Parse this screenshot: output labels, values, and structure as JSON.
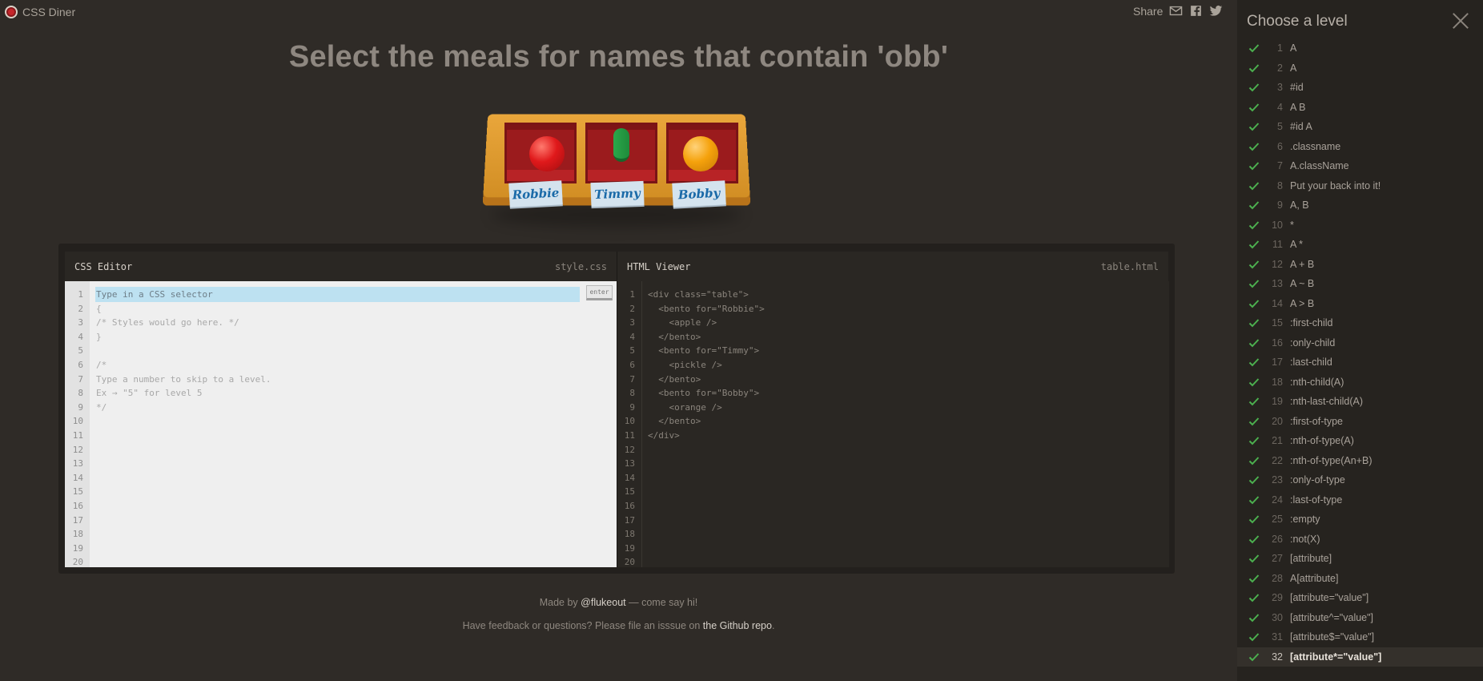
{
  "app": {
    "name": "CSS Diner"
  },
  "share": {
    "label": "Share",
    "icons": [
      "mail-icon",
      "facebook-icon",
      "twitter-icon"
    ]
  },
  "instruction": "Select the meals for names that contain 'obb'",
  "table": {
    "bentos": [
      {
        "name": "Robbie",
        "food": "apple"
      },
      {
        "name": "Timmy",
        "food": "pickle"
      },
      {
        "name": "Bobby",
        "food": "orange"
      }
    ]
  },
  "css_editor": {
    "title": "CSS Editor",
    "file": "style.css",
    "placeholder": "Type in a CSS selector",
    "enter_label": "enter",
    "lines": [
      "",
      "{",
      "/* Styles would go here. */",
      "}",
      "",
      "/*",
      "Type a number to skip to a level.",
      "Ex → \"5\" for level 5",
      "*/"
    ],
    "line_count": 20
  },
  "html_viewer": {
    "title": "HTML Viewer",
    "file": "table.html",
    "lines": [
      "<div class=\"table\">",
      "  <bento for=\"Robbie\">",
      "    <apple />",
      "  </bento>",
      "  <bento for=\"Timmy\">",
      "    <pickle />",
      "  </bento>",
      "  <bento for=\"Bobby\">",
      "    <orange />",
      "  </bento>",
      "</div>"
    ],
    "line_count": 20
  },
  "footer": {
    "made_by_prefix": "Made by ",
    "made_by_link": "@flukeout",
    "made_by_suffix": " — come say hi!",
    "feedback_prefix": "Have feedback or questions? Please file an isssue on ",
    "feedback_link": "the Github repo",
    "feedback_suffix": "."
  },
  "sidebar": {
    "title": "Choose a level",
    "current_level": 32,
    "check_color": "#4cb04f",
    "levels": [
      "A",
      "A",
      "#id",
      "A B",
      "#id  A",
      ".classname",
      "A.className",
      "Put your back into it!",
      "A, B",
      "*",
      "A *",
      "A + B",
      "A ~ B",
      "A > B",
      ":first-child",
      ":only-child",
      ":last-child",
      ":nth-child(A)",
      ":nth-last-child(A)",
      ":first-of-type",
      ":nth-of-type(A)",
      ":nth-of-type(An+B)",
      ":only-of-type",
      ":last-of-type",
      ":empty",
      ":not(X)",
      "[attribute]",
      "A[attribute]",
      "[attribute=\"value\"]",
      "[attribute^=\"value\"]",
      "[attribute$=\"value\"]",
      "[attribute*=\"value\"]"
    ]
  }
}
